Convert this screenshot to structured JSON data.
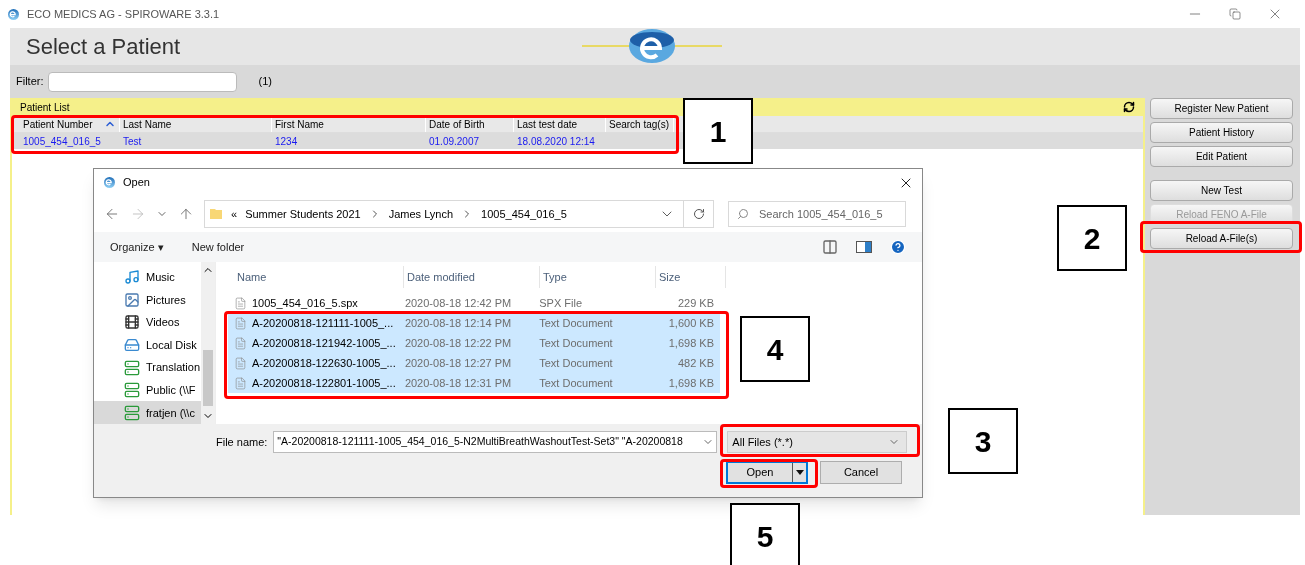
{
  "window": {
    "title": "ECO MEDICS AG - SPIROWARE 3.3.1"
  },
  "page_title": "Select a Patient",
  "filter": {
    "label": "Filter:",
    "count": "(1)"
  },
  "patient_list": {
    "title": "Patient List",
    "columns": [
      {
        "label": "Patient Number",
        "sorted": true
      },
      {
        "label": "Last Name",
        "sorted": false
      },
      {
        "label": "First Name",
        "sorted": false
      },
      {
        "label": "Date of Birth",
        "sorted": false
      },
      {
        "label": "Last test date",
        "sorted": false
      },
      {
        "label": "Search tag(s)",
        "sorted": false
      }
    ],
    "rows": [
      {
        "cells": [
          "1005_454_016_5",
          "Test",
          "1234",
          "01.09.2007",
          "18.08.2020 12:14",
          ""
        ],
        "selected": true
      }
    ]
  },
  "actions": [
    {
      "label": "Register New Patient",
      "disabled": false
    },
    {
      "label": "Patient History",
      "disabled": false
    },
    {
      "label": "Edit Patient",
      "disabled": false
    },
    {
      "label": "New Test",
      "disabled": false
    },
    {
      "label": "Reload FENO A-File",
      "disabled": true
    },
    {
      "label": "Reload A-File(s)",
      "disabled": false
    }
  ],
  "dialog": {
    "title": "Open",
    "breadcrumb": [
      "«",
      "Summer Students 2021",
      "James Lynch",
      "1005_454_016_5"
    ],
    "search_placeholder": "Search 1005_454_016_5",
    "toolbar": [
      "Organize ▾",
      "New folder"
    ],
    "nav": [
      {
        "label": "Music",
        "kind": "music",
        "selected": false
      },
      {
        "label": "Pictures",
        "kind": "pictures",
        "selected": false
      },
      {
        "label": "Videos",
        "kind": "videos",
        "selected": false
      },
      {
        "label": "Local Disk",
        "kind": "disk",
        "selected": false
      },
      {
        "label": "Translation",
        "kind": "network",
        "selected": false
      },
      {
        "label": "Public (\\\\F",
        "kind": "network",
        "selected": false
      },
      {
        "label": "fratjen (\\\\c",
        "kind": "network",
        "selected": true
      }
    ],
    "columns": [
      "Name",
      "Date modified",
      "Type",
      "Size"
    ],
    "files": [
      {
        "name": "1005_454_016_5.spx",
        "date": "2020-08-18 12:42 PM",
        "type": "SPX File",
        "size": "229 KB",
        "selected": false
      },
      {
        "name": "A-20200818-121111-1005_...",
        "date": "2020-08-18 12:14 PM",
        "type": "Text Document",
        "size": "1,600 KB",
        "selected": true
      },
      {
        "name": "A-20200818-121942-1005_...",
        "date": "2020-08-18 12:22 PM",
        "type": "Text Document",
        "size": "1,698 KB",
        "selected": true
      },
      {
        "name": "A-20200818-122630-1005_...",
        "date": "2020-08-18 12:27 PM",
        "type": "Text Document",
        "size": "482 KB",
        "selected": true
      },
      {
        "name": "A-20200818-122801-1005_...",
        "date": "2020-08-18 12:31 PM",
        "type": "Text Document",
        "size": "1,698 KB",
        "selected": true
      }
    ],
    "file_name_label": "File name:",
    "file_name_value": "\"A-20200818-121111-1005_454_016_5-N2MultiBreathWashoutTest-Set3\" \"A-20200818",
    "file_type": "All Files (*.*)",
    "buttons": [
      "Open",
      "Cancel"
    ]
  },
  "callouts": [
    "1",
    "2",
    "3",
    "4",
    "5"
  ]
}
